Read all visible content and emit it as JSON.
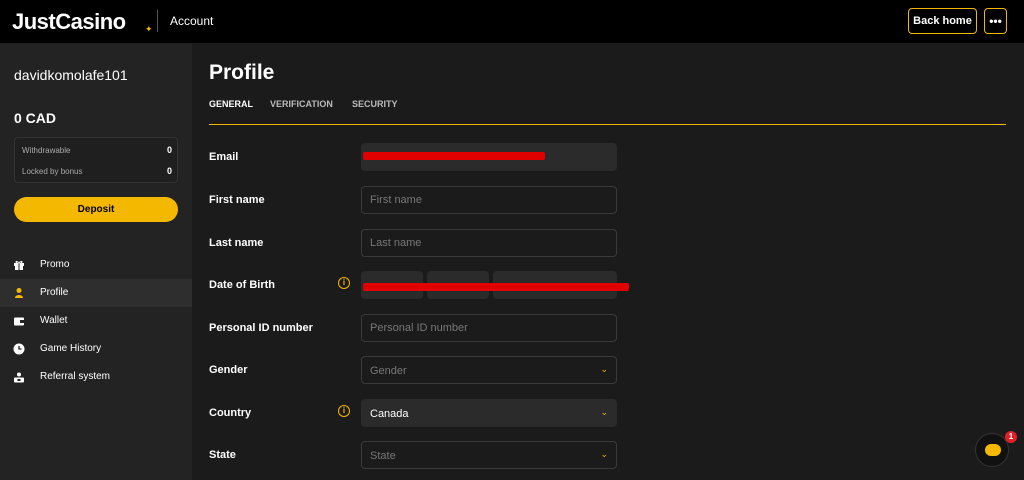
{
  "header": {
    "logo": "JustCasino",
    "section_title": "Account",
    "back_home_label": "Back home",
    "more_label": "•••"
  },
  "sidebar": {
    "username": "davidkomolafe101",
    "balance": "0 CAD",
    "withdrawable_label": "Withdrawable",
    "withdrawable_value": "0",
    "locked_label": "Locked by bonus",
    "locked_value": "0",
    "deposit_label": "Deposit",
    "items": [
      {
        "label": "Promo",
        "icon": "gift-icon",
        "active": false
      },
      {
        "label": "Profile",
        "icon": "user-icon",
        "active": true
      },
      {
        "label": "Wallet",
        "icon": "wallet-icon",
        "active": false
      },
      {
        "label": "Game History",
        "icon": "clock-icon",
        "active": false
      },
      {
        "label": "Referral system",
        "icon": "referral-icon",
        "active": false
      }
    ]
  },
  "main": {
    "title": "Profile",
    "tabs": [
      {
        "label": "GENERAL",
        "active": true
      },
      {
        "label": "VERIFICATION",
        "active": false
      },
      {
        "label": "SECURITY",
        "active": false
      }
    ],
    "form": {
      "email_label": "Email",
      "first_name_label": "First name",
      "first_name_placeholder": "First name",
      "last_name_label": "Last name",
      "last_name_placeholder": "Last name",
      "dob_label": "Date of Birth",
      "personal_id_label": "Personal ID number",
      "personal_id_placeholder": "Personal ID number",
      "gender_label": "Gender",
      "gender_value": "Gender",
      "country_label": "Country",
      "country_value": "Canada",
      "state_label": "State",
      "state_value": "State"
    }
  },
  "chat": {
    "badge": "1"
  },
  "colors": {
    "accent": "#f5b800",
    "redaction": "#e00000",
    "badge": "#e0202a"
  }
}
